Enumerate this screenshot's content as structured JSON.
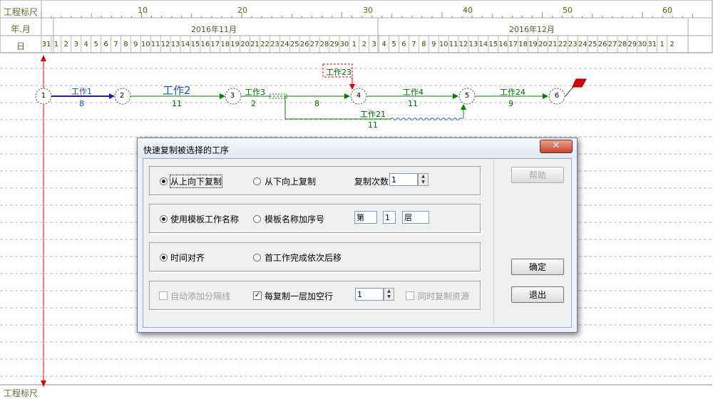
{
  "ruler": {
    "row_labels": [
      "工程标尺",
      "年.月",
      "日"
    ],
    "scale_ticks": [
      "10",
      "20",
      "30",
      "40",
      "50",
      "60"
    ],
    "months": [
      "2016年11月",
      "2016年12月"
    ],
    "days_nov": [
      "31",
      "1",
      "2",
      "3",
      "4",
      "5",
      "6",
      "7",
      "8",
      "9",
      "10",
      "11",
      "12",
      "13",
      "14",
      "15",
      "16",
      "17",
      "18",
      "19",
      "20",
      "21",
      "22",
      "23",
      "24",
      "25",
      "26",
      "27",
      "28",
      "29",
      "30"
    ],
    "days_dec": [
      "1",
      "2",
      "3",
      "4",
      "5",
      "6",
      "7",
      "8",
      "9",
      "10",
      "11",
      "12",
      "13",
      "14",
      "15",
      "16",
      "17",
      "18",
      "19",
      "20",
      "21",
      "22",
      "23",
      "24",
      "25",
      "26",
      "27",
      "28",
      "29",
      "30",
      "31",
      "1",
      "2"
    ],
    "bottom_label": "工程标尺"
  },
  "network": {
    "nodes": [
      "1",
      "2",
      "3",
      "4",
      "5",
      "6"
    ],
    "works": [
      {
        "name": "工作1",
        "duration": "8"
      },
      {
        "name": "工作2",
        "duration": "11"
      },
      {
        "name": "工作3",
        "duration": "2"
      },
      {
        "name": "工作23",
        "duration": ""
      },
      {
        "name": "",
        "duration": "8"
      },
      {
        "name": "工作4",
        "duration": "11"
      },
      {
        "name": "工作24",
        "duration": "9"
      },
      {
        "name": "工作21",
        "duration": "11"
      }
    ],
    "colors": {
      "critical": "#1a1ab3",
      "normal": "#008000",
      "today_line": "#e00000",
      "flag": "#e00000"
    }
  },
  "dialog": {
    "title": "快速复制被选择的工序",
    "close_icon": "close-icon",
    "group1": {
      "opt_top_down": "从上向下复制",
      "opt_bottom_up": "从下向上复制",
      "copy_times_label": "复制次数",
      "copy_times_value": "1"
    },
    "group2": {
      "opt_template_name": "使用模板工作名称",
      "opt_template_seq": "模板名称加序号",
      "prefix_value": "第",
      "index_value": "1",
      "suffix_value": "层"
    },
    "group3": {
      "opt_time_align": "时间对齐",
      "opt_shift": "首工作完成依次后移"
    },
    "group4": {
      "opt_auto_separator": "自动添加分隔线",
      "opt_blank_row": "每复制一层加空行",
      "blank_row_value": "1",
      "opt_copy_resources": "同时复制资源"
    },
    "buttons": {
      "help": "帮助",
      "ok": "确定",
      "exit": "退出"
    }
  }
}
